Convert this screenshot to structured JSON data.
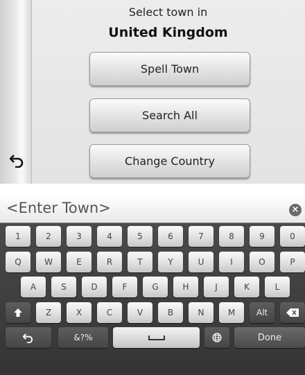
{
  "town_menu": {
    "prompt": "Select town in",
    "country": "United Kingdom",
    "buttons": [
      "Spell Town",
      "Search All",
      "Change Country"
    ]
  },
  "entry": {
    "placeholder": "<Enter Town>"
  },
  "keyboard": {
    "number_row": [
      "1",
      "2",
      "3",
      "4",
      "5",
      "6",
      "7",
      "8",
      "9",
      "0"
    ],
    "row1": [
      "Q",
      "W",
      "E",
      "R",
      "T",
      "Y",
      "U",
      "I",
      "O",
      "P"
    ],
    "row2": [
      "A",
      "S",
      "D",
      "F",
      "G",
      "H",
      "J",
      "K",
      "L"
    ],
    "row3": [
      "Z",
      "X",
      "C",
      "V",
      "B",
      "N",
      "M"
    ],
    "alt_label": "Alt",
    "symbols_label": "&?%",
    "done_label": "Done"
  }
}
